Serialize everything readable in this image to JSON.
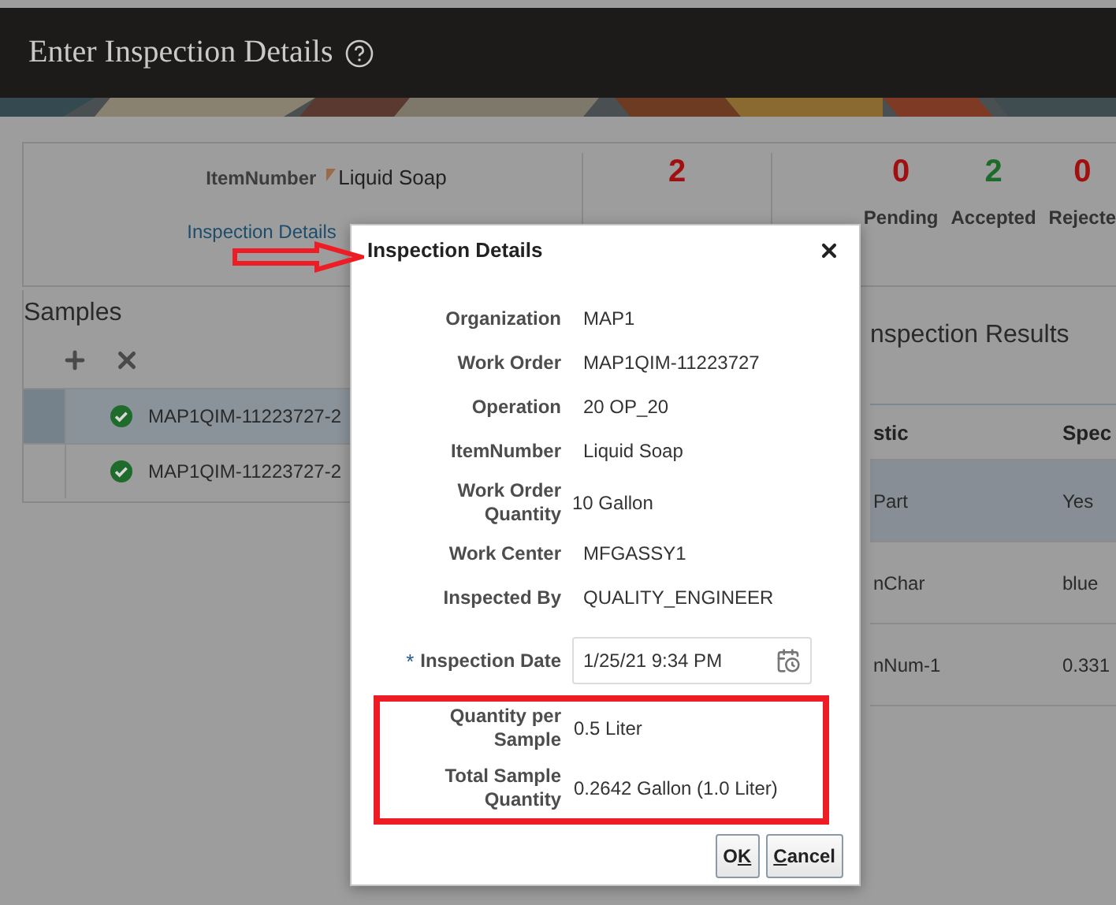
{
  "header": {
    "title": "Enter Inspection Details"
  },
  "summary": {
    "item_label": "ItemNumber",
    "item_value": "Liquid Soap",
    "details_link": "Inspection Details",
    "samples_count": {
      "value": "2",
      "color": "#a11010"
    },
    "stats": [
      {
        "value": "0",
        "label": "Pending",
        "color": "#a11010"
      },
      {
        "value": "2",
        "label": "Accepted",
        "color": "#1d6b2a"
      },
      {
        "value": "0",
        "label": "Rejecte",
        "color": "#a11010"
      }
    ]
  },
  "samples": {
    "title": "Samples",
    "rows": [
      {
        "name": "MAP1QIM-11223727-2",
        "selected": true
      },
      {
        "name": "MAP1QIM-11223727-2",
        "selected": false
      }
    ]
  },
  "results": {
    "title": "nspection Results",
    "columns": [
      "stic",
      "Spec"
    ],
    "rows": [
      {
        "cells": [
          "Part",
          "Yes"
        ],
        "selected": true
      },
      {
        "cells": [
          "nChar",
          "blue"
        ],
        "selected": false
      },
      {
        "cells": [
          "nNum-1",
          "0.331"
        ],
        "selected": false
      }
    ]
  },
  "dialog": {
    "title": "Inspection Details",
    "fields": [
      {
        "label": "Organization",
        "value": "MAP1",
        "kind": "text"
      },
      {
        "label": "Work Order",
        "value": "MAP1QIM-11223727",
        "kind": "text"
      },
      {
        "label": "Operation",
        "value": "20 OP_20",
        "kind": "text"
      },
      {
        "label": "ItemNumber",
        "value": "Liquid Soap",
        "kind": "text"
      },
      {
        "label": "Work Order Quantity",
        "value": "10 Gallon",
        "kind": "text"
      },
      {
        "label": "Work Center",
        "value": "MFGASSY1",
        "kind": "text"
      },
      {
        "label": "Inspected By",
        "value": "QUALITY_ENGINEER",
        "kind": "text"
      },
      {
        "label": "Inspection Date",
        "value": "1/25/21 9:34 PM",
        "kind": "date",
        "required_mark": "*"
      }
    ],
    "highlighted_fields": [
      {
        "label": "Quantity per Sample",
        "value": "0.5 Liter"
      },
      {
        "label": "Total Sample Quantity",
        "value": "0.2642 Gallon (1.0 Liter)"
      }
    ],
    "buttons": [
      {
        "label_start": "O",
        "access_key": "K"
      },
      {
        "access_key": "C",
        "label_end": "ancel"
      }
    ]
  }
}
